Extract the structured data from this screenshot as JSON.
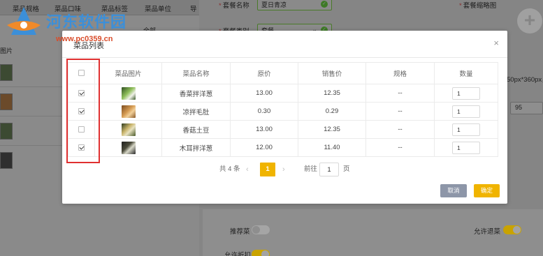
{
  "background": {
    "left_headers": [
      "菜品规格",
      "菜品口味",
      "菜品标签",
      "菜品单位",
      "导"
    ],
    "left_all_option": "全部",
    "left_image_label": "图片",
    "meal_name_label": "套餐名称",
    "meal_name_value": "夏日青凉",
    "meal_thumb_label": "套餐缩略图",
    "meal_type_label": "套餐类别",
    "meal_type_value": "套餐",
    "image_hint": "50px*360px，",
    "price_value": "95",
    "recommend_label": "推荐菜",
    "allow_return_label": "允许退菜",
    "allow_discount_label": "允许折扣",
    "colors": {
      "accent": "#f0b400",
      "valid": "#3d7a26",
      "highlight": "#e03030"
    }
  },
  "watermark": {
    "title": "河东软件园",
    "url": "www.pc0359.cn"
  },
  "modal": {
    "title": "菜品列表",
    "close_icon": "×",
    "columns": [
      "菜品图片",
      "菜品名称",
      "原价",
      "销售价",
      "规格",
      "数量"
    ],
    "rows": [
      {
        "checked": true,
        "name": "香菜拌洋葱",
        "original_price": "13.00",
        "sale_price": "12.35",
        "spec": "--",
        "quantity": "1"
      },
      {
        "checked": true,
        "name": "凉拌毛肚",
        "original_price": "0.30",
        "sale_price": "0.29",
        "spec": "--",
        "quantity": "1"
      },
      {
        "checked": false,
        "name": "香菇土豆",
        "original_price": "13.00",
        "sale_price": "12.35",
        "spec": "--",
        "quantity": "1"
      },
      {
        "checked": true,
        "name": "木耳拌洋葱",
        "original_price": "12.00",
        "sale_price": "11.40",
        "spec": "--",
        "quantity": "1"
      }
    ],
    "pager": {
      "total": "共 4 条",
      "prev_icon": "‹",
      "current_page": "1",
      "next_icon": "›",
      "goto_label": "前往",
      "goto_value": "1",
      "page_suffix": "页"
    },
    "cancel_label": "取消",
    "ok_label": "确定"
  }
}
